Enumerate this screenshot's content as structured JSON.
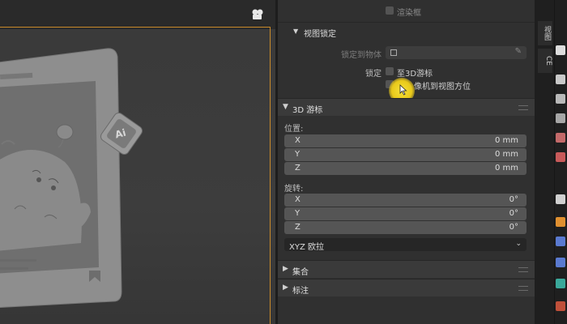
{
  "panel": {
    "top_checkbox_label": "渲染框",
    "view_lock": {
      "title": "视图锁定",
      "lock_to_object_label": "锁定到物体",
      "lock_label": "锁定",
      "to_3d_cursor": "至3D游标",
      "camera_to_view": "像机到视图方位"
    },
    "cursor": {
      "title": "3D 游标",
      "location_label": "位置:",
      "location": [
        {
          "axis": "X",
          "value": "0 mm"
        },
        {
          "axis": "Y",
          "value": "0 mm"
        },
        {
          "axis": "Z",
          "value": "0 mm"
        }
      ],
      "rotation_label": "旋转:",
      "rotation": [
        {
          "axis": "X",
          "value": "0°"
        },
        {
          "axis": "Y",
          "value": "0°"
        },
        {
          "axis": "Z",
          "value": "0°"
        }
      ],
      "rotation_mode": "XYZ 欧拉"
    },
    "collections": {
      "title": "集合"
    },
    "annotations": {
      "title": "标注"
    }
  },
  "viewport": {
    "badge_text": "Ai"
  },
  "strip": {
    "tabs": [
      "视图",
      "CE"
    ]
  },
  "colors": {
    "accent_orange": "#c98a2a",
    "highlight_yellow": "#f0d21c",
    "panel_bg": "#303030"
  }
}
